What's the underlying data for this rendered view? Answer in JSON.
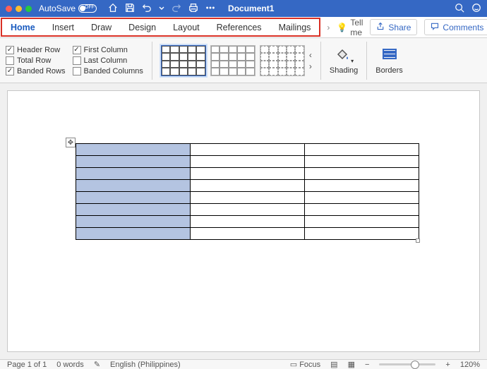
{
  "titlebar": {
    "autosave_label": "AutoSave",
    "autosave_state": "OFF",
    "doc_title": "Document1"
  },
  "tabs": {
    "home": "Home",
    "insert": "Insert",
    "draw": "Draw",
    "design": "Design",
    "layout": "Layout",
    "references": "References",
    "mailings": "Mailings",
    "tellme": "Tell me",
    "share": "Share",
    "comments": "Comments"
  },
  "table_options": {
    "header_row": "Header Row",
    "first_column": "First Column",
    "total_row": "Total Row",
    "last_column": "Last Column",
    "banded_rows": "Banded Rows",
    "banded_columns": "Banded Columns"
  },
  "ribbon_buttons": {
    "shading": "Shading",
    "borders": "Borders"
  },
  "status": {
    "page": "Page 1 of 1",
    "words": "0 words",
    "language": "English (Philippines)",
    "focus": "Focus",
    "zoom": "120%"
  },
  "colors": {
    "accent": "#3568c4",
    "highlight_box": "#d93025",
    "banded_fill": "#b4c4e1"
  }
}
